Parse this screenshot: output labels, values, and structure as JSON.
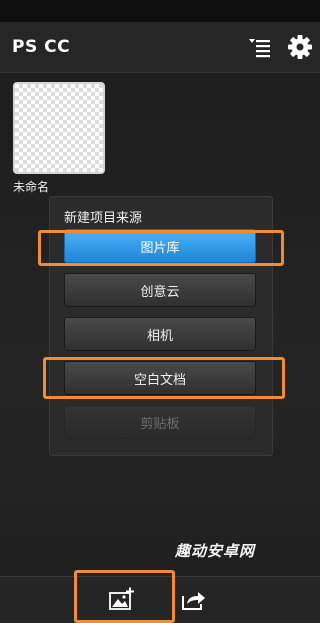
{
  "app": {
    "title": "PS CC"
  },
  "document": {
    "name": "未命名"
  },
  "new_project_menu": {
    "title": "新建项目来源",
    "items": [
      {
        "label": "图片库",
        "state": "selected"
      },
      {
        "label": "创意云",
        "state": "normal"
      },
      {
        "label": "相机",
        "state": "normal"
      },
      {
        "label": "空白文档",
        "state": "normal"
      },
      {
        "label": "剪贴板",
        "state": "disabled"
      }
    ]
  },
  "watermark": "趣动安卓网",
  "icons": {
    "top": [
      "sort-list-icon",
      "gear-icon"
    ],
    "bottom": [
      "add-image-icon",
      "share-icon"
    ]
  },
  "colors": {
    "accent_blue": "#2b95e6",
    "highlight_orange": "#f28c32",
    "background": "#1d1d1d"
  }
}
